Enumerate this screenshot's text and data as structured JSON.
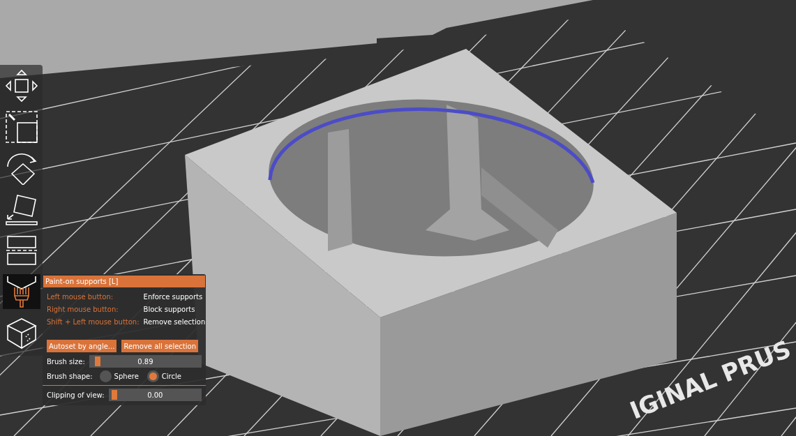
{
  "viewport": {
    "bed_label": "IGINAL PRUS"
  },
  "toolbar": [
    {
      "kind": "move",
      "selected": false
    },
    {
      "kind": "scale",
      "selected": false
    },
    {
      "kind": "rotate",
      "selected": false
    },
    {
      "kind": "place",
      "selected": false
    },
    {
      "kind": "cut",
      "selected": false
    },
    {
      "kind": "paint",
      "selected": true
    },
    {
      "kind": "seam",
      "selected": false
    }
  ],
  "panel": {
    "title": "Paint-on supports [L]",
    "bindings": [
      {
        "key": "Left mouse button:",
        "action": "Enforce supports"
      },
      {
        "key": "Right mouse button:",
        "action": "Block supports"
      },
      {
        "key": "Shift + Left mouse button:",
        "action": "Remove selection"
      }
    ],
    "buttons": [
      "Autoset by angle...",
      "Remove all selection"
    ],
    "brush_size": {
      "label": "Brush size:",
      "reading": "0.89",
      "level": 0.03
    },
    "brush_shape": {
      "label": "Brush shape:",
      "options": [
        {
          "label": "Sphere",
          "selected": false
        },
        {
          "label": "Circle",
          "selected": true
        }
      ]
    },
    "clipping": {
      "label": "Clipping of view:",
      "reading": "0.00",
      "level": 0
    }
  }
}
